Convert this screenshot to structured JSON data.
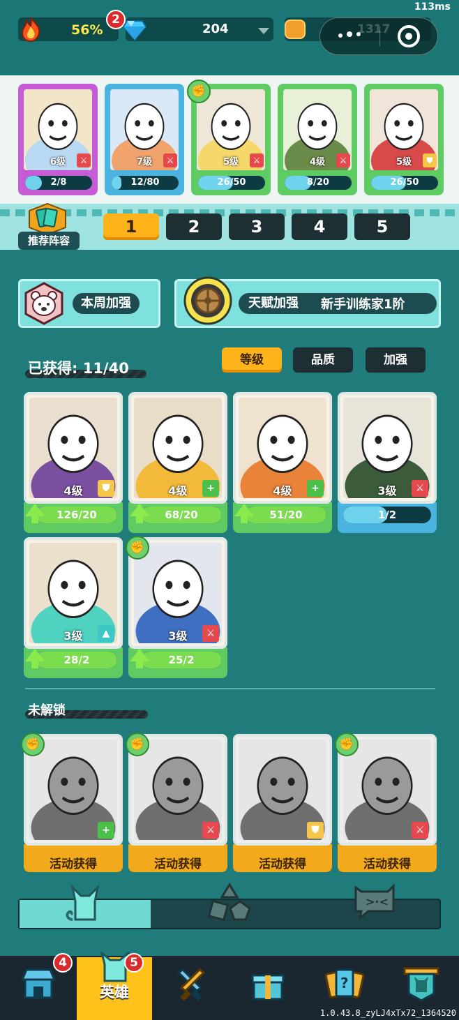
{
  "status": {
    "latency": "113ms",
    "fire_percent": "56%",
    "fire_badge": "2",
    "gems": "204",
    "coins": "1317"
  },
  "lineup": [
    {
      "level": "6级",
      "progress": "2/8",
      "progress_ratio": 0.25,
      "rarity_color": "#c65bd6",
      "role_icon": "sword-icon"
    },
    {
      "level": "7级",
      "progress": "12/80",
      "progress_ratio": 0.15,
      "rarity_color": "#4ab3e0",
      "role_icon": "sword-icon"
    },
    {
      "level": "5级",
      "progress": "26/50",
      "progress_ratio": 0.52,
      "rarity_color": "#5fcb63",
      "role_icon": "sword-icon",
      "fist": true
    },
    {
      "level": "4级",
      "progress": "8/20",
      "progress_ratio": 0.4,
      "rarity_color": "#5fcb63",
      "role_icon": "sword-icon"
    },
    {
      "level": "5级",
      "progress": "26/50",
      "progress_ratio": 0.52,
      "rarity_color": "#5fcb63",
      "role_icon": "shield-icon"
    }
  ],
  "recommended": {
    "label": "推荐阵容"
  },
  "teams": [
    "1",
    "2",
    "3",
    "4",
    "5"
  ],
  "active_team": "1",
  "weekly_boost": {
    "label": "本周加强"
  },
  "talent_boost": {
    "label": "天赋加强",
    "value": "新手训练家1阶"
  },
  "collection": {
    "title": "已获得: 11/40",
    "sort_tabs": [
      "等级",
      "品质",
      "加强"
    ],
    "active_sort": "等级",
    "heroes": [
      {
        "level": "4级",
        "progress": "126/20",
        "progress_ratio": 1.0,
        "role_icon": "shield-icon",
        "upgradable": true
      },
      {
        "level": "4级",
        "progress": "68/20",
        "progress_ratio": 1.0,
        "role_icon": "plus-icon",
        "upgradable": true
      },
      {
        "level": "4级",
        "progress": "51/20",
        "progress_ratio": 1.0,
        "role_icon": "plus-icon",
        "upgradable": true
      },
      {
        "level": "3级",
        "progress": "1/2",
        "progress_ratio": 0.5,
        "role_icon": "sword-icon",
        "upgradable": false
      },
      {
        "level": "3级",
        "progress": "28/2",
        "progress_ratio": 1.0,
        "role_icon": "arrow-icon",
        "upgradable": true
      },
      {
        "level": "3级",
        "progress": "25/2",
        "progress_ratio": 1.0,
        "role_icon": "sword-icon",
        "upgradable": true,
        "fist": true
      }
    ]
  },
  "locked": {
    "title": "未解锁",
    "heroes": [
      {
        "action": "活动获得",
        "role_icon": "plus-icon",
        "fist": true
      },
      {
        "action": "活动获得",
        "role_icon": "sword-icon",
        "fist": true
      },
      {
        "action": "活动获得",
        "role_icon": "shield-icon",
        "fist": false
      },
      {
        "action": "活动获得",
        "role_icon": "sword-icon",
        "fist": true
      }
    ]
  },
  "bottom_nav": {
    "shop_badge": "4",
    "heroes_label": "英雄",
    "heroes_badge": "5"
  },
  "version": "1.0.43.8_zyLJ4xTx72_1364520",
  "colors": {
    "background": "#1f7c7b",
    "accent": "#ffb31a",
    "green_bar": "#7bdc4f",
    "blue_bar": "#6fd3ee"
  }
}
